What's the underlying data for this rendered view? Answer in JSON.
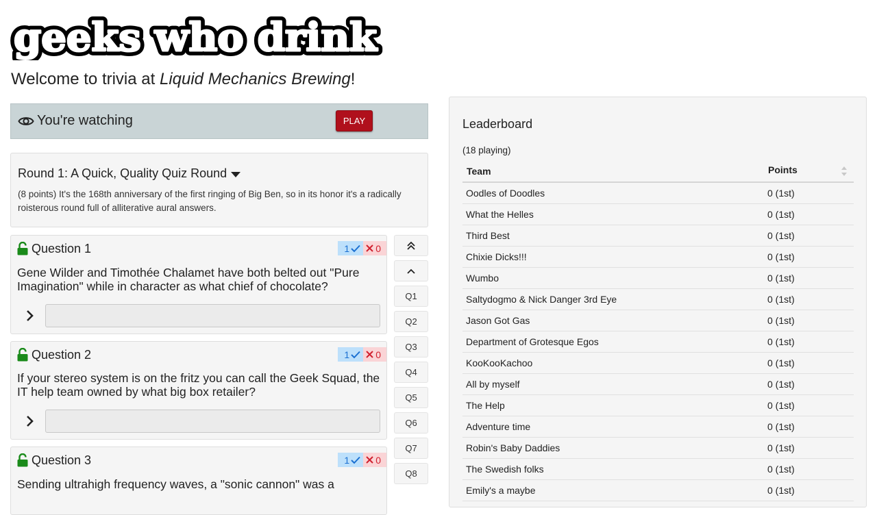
{
  "logo_text": "geeks who drink",
  "welcome": {
    "prefix": "Welcome to trivia at ",
    "venue": "Liquid Mechanics Brewing",
    "suffix": "!"
  },
  "watch_bar": {
    "text": "You're watching",
    "play_label": "PLAY"
  },
  "round": {
    "title": "Round 1: A Quick, Quality Quiz Round",
    "description": "(8 points) It's the 168th anniversary of the first ringing of Big Ben, so in its honor it's a radically roisterous round full of alliterative aural answers."
  },
  "questions": [
    {
      "label": "Question 1",
      "text": "Gene Wilder and Timothée Chalamet have both belted out \"Pure Imagination\" while in character as what chief of chocolate?",
      "correct": "1",
      "wrong": "0"
    },
    {
      "label": "Question 2",
      "text": "If your stereo system is on the fritz you can call the Geek Squad, the IT help team owned by what big box retailer?",
      "correct": "1",
      "wrong": "0"
    },
    {
      "label": "Question 3",
      "text": "Sending ultrahigh frequency waves, a \"sonic cannon\" was a",
      "correct": "1",
      "wrong": "0"
    }
  ],
  "nav": {
    "items": [
      "Q1",
      "Q2",
      "Q3",
      "Q4",
      "Q5",
      "Q6",
      "Q7",
      "Q8"
    ]
  },
  "leaderboard": {
    "title": "Leaderboard",
    "count": "(18 playing)",
    "col_team": "Team",
    "col_points": "Points",
    "rows": [
      {
        "team": "Oodles of Doodles",
        "points": "0 (1st)"
      },
      {
        "team": "What the Helles",
        "points": "0 (1st)"
      },
      {
        "team": "Third Best",
        "points": "0 (1st)"
      },
      {
        "team": "Chixie Dicks!!!",
        "points": "0 (1st)"
      },
      {
        "team": "Wumbo",
        "points": "0 (1st)"
      },
      {
        "team": "Saltydogmo & Nick Danger 3rd Eye",
        "points": "0 (1st)"
      },
      {
        "team": "Jason Got Gas",
        "points": "0 (1st)"
      },
      {
        "team": "Department of Grotesque Egos",
        "points": "0 (1st)"
      },
      {
        "team": "KooKooKachoo",
        "points": "0 (1st)"
      },
      {
        "team": "All by myself",
        "points": "0 (1st)"
      },
      {
        "team": "The Help",
        "points": "0 (1st)"
      },
      {
        "team": "Adventure time",
        "points": "0 (1st)"
      },
      {
        "team": "Robin's Baby Daddies",
        "points": "0 (1st)"
      },
      {
        "team": "The Swedish folks",
        "points": "0 (1st)"
      },
      {
        "team": "Emily's a maybe",
        "points": "0 (1st)"
      }
    ]
  },
  "colors": {
    "play": "#b0101c",
    "watch_bar": "#c9d4d6",
    "lock": "#1a8a1a",
    "correct": "#1a6fd1",
    "wrong": "#d0202e"
  },
  "icons": {
    "watch": "eye-icon",
    "lock": "unlocked-padlock-icon",
    "expand": "chevron-right-icon",
    "caret": "caret-down-icon",
    "sort": "sort-icon"
  }
}
